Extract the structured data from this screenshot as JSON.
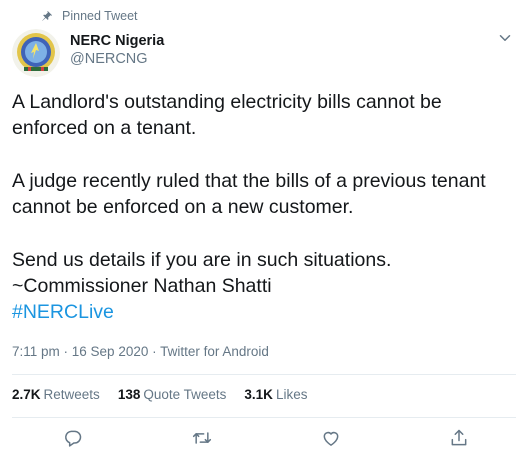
{
  "pinned": {
    "label": "Pinned Tweet",
    "icon": "pin-icon"
  },
  "author": {
    "name": "NERC Nigeria",
    "handle": "@NERCNG",
    "avatar_icon": "nerc-logo-icon"
  },
  "tweet": {
    "paragraphs": [
      "A Landlord's outstanding electricity bills cannot be enforced on a tenant.",
      "A judge recently ruled that the bills of a previous tenant cannot be enforced on a new customer.",
      "Send us details if you are in such situations.",
      "~Commissioner Nathan Shatti"
    ],
    "hashtag": "#NERCLive"
  },
  "meta": {
    "time": "7:11 pm",
    "separator1": " · ",
    "date": "16 Sep 2020",
    "separator2": " · ",
    "source": "Twitter for Android"
  },
  "stats": {
    "retweets": {
      "count": "2.7K",
      "label": "Retweets"
    },
    "quotes": {
      "count": "138",
      "label": "Quote Tweets"
    },
    "likes": {
      "count": "3.1K",
      "label": "Likes"
    }
  },
  "actions": [
    "reply-icon",
    "retweet-icon",
    "like-icon",
    "share-icon"
  ],
  "colors": {
    "text": "#14171a",
    "muted": "#657786",
    "link": "#1b95e0",
    "divider": "#e6ecf0"
  }
}
